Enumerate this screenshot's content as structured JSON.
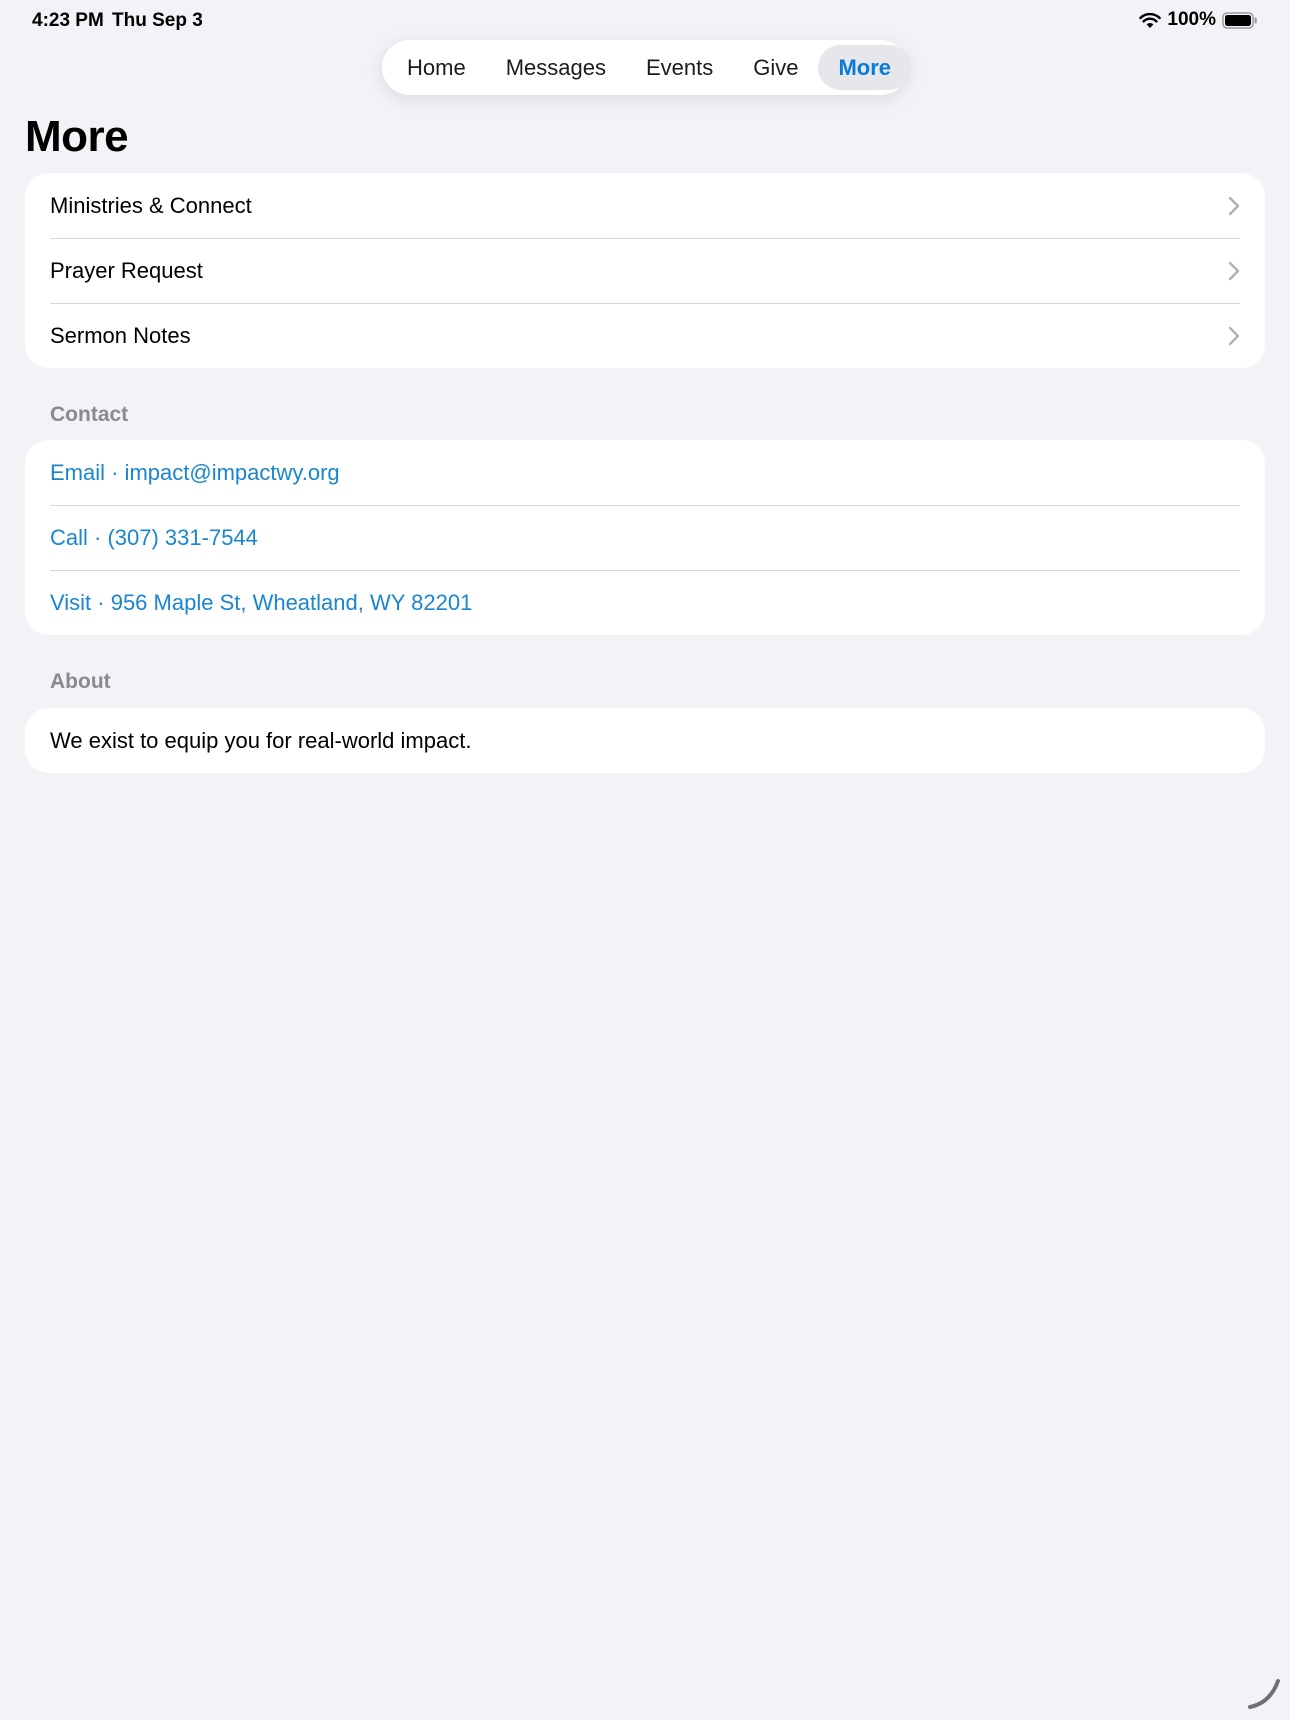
{
  "status_bar": {
    "time": "4:23 PM",
    "date": "Thu Sep 3",
    "battery_percent": "100%",
    "wifi_icon": "wifi-icon",
    "battery_icon": "battery-full-icon"
  },
  "tabs": [
    {
      "label": "Home",
      "active": false
    },
    {
      "label": "Messages",
      "active": false
    },
    {
      "label": "Events",
      "active": false
    },
    {
      "label": "Give",
      "active": false
    },
    {
      "label": "More",
      "active": true
    }
  ],
  "page": {
    "title": "More"
  },
  "menu": {
    "items": [
      {
        "label": "Ministries & Connect",
        "icon": "chevron-right-icon"
      },
      {
        "label": "Prayer Request",
        "icon": "chevron-right-icon"
      },
      {
        "label": "Sermon Notes",
        "icon": "chevron-right-icon"
      }
    ]
  },
  "contact": {
    "header": "Contact",
    "items": [
      {
        "label": "Email · impact@impactwy.org"
      },
      {
        "label": "Call · (307) 331-7544"
      },
      {
        "label": "Visit · 956 Maple St, Wheatland, WY 82201"
      }
    ]
  },
  "about": {
    "header": "About",
    "text": "We exist to equip you for real-world impact."
  },
  "colors": {
    "background": "#f2f2f7",
    "accent": "#0a7bd8",
    "link": "#1a86cf",
    "section_header": "#8a8a8e",
    "separator": "#d6d6da"
  }
}
